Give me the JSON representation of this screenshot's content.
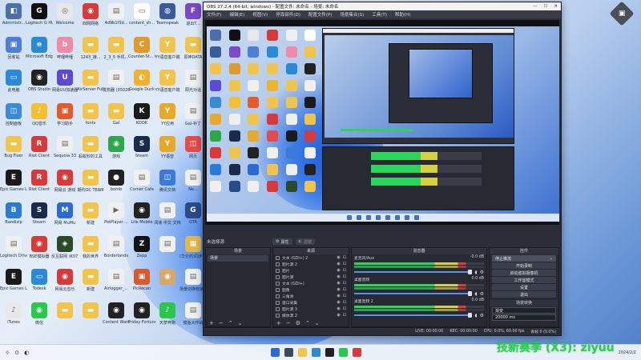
{
  "desktop": {
    "icons": [
      {
        "label": "Administr...",
        "color": "#4d6fa8",
        "glyph": "◧",
        "col": 0,
        "row": 0
      },
      {
        "label": "Logitech G HUB",
        "color": "#111111",
        "glyph": "G",
        "col": 1,
        "row": 0
      },
      {
        "label": "Welcome",
        "color": "#e8e8e8",
        "glyph": "◎",
        "col": 2,
        "row": 0
      },
      {
        "label": "四网网络",
        "color": "#d83a3a",
        "glyph": "◉",
        "col": 3,
        "row": 0
      },
      {
        "label": "4d9b1f3d...",
        "color": "#f0f0f0",
        "glyph": "▤",
        "col": 4,
        "row": 0
      },
      {
        "label": "content_sh...",
        "color": "#ffffff",
        "glyph": "▭",
        "col": 5,
        "row": 0
      },
      {
        "label": "Teamspeak",
        "color": "#3a5a9a",
        "glyph": "◍",
        "col": 6,
        "row": 0
      },
      {
        "label": "退出T...",
        "color": "#7a4ac8",
        "glyph": "F",
        "col": 7,
        "row": 0
      },
      {
        "label": "回收站",
        "color": "#4e7fd8",
        "glyph": "▣",
        "col": 0,
        "row": 1
      },
      {
        "label": "Microsoft Edge",
        "color": "#2a8ad8",
        "glyph": "e",
        "col": 1,
        "row": 1
      },
      {
        "label": "哔哩哔哩",
        "color": "#f08aa8",
        "glyph": "b",
        "col": 2,
        "row": 1
      },
      {
        "label": "1243_接...",
        "color": "#f2c44a",
        "glyph": "▬",
        "col": 3,
        "row": 1
      },
      {
        "label": "2_3_5 手机...",
        "color": "#f2c44a",
        "glyph": "▬",
        "col": 4,
        "row": 1
      },
      {
        "label": "Counter-St... Global Of...",
        "color": "#e09a2a",
        "glyph": "C",
        "col": 5,
        "row": 1
      },
      {
        "label": "YY语音客户端",
        "color": "#f2c44a",
        "glyph": "Y",
        "col": 6,
        "row": 1
      },
      {
        "label": "原神DATA",
        "color": "#f2c44a",
        "glyph": "▬",
        "col": 7,
        "row": 1
      },
      {
        "label": "此电脑",
        "color": "#2a8ad8",
        "glyph": "▭",
        "col": 0,
        "row": 2
      },
      {
        "label": "OBS Studio",
        "color": "#222222",
        "glyph": "◉",
        "col": 1,
        "row": 2
      },
      {
        "label": "网易UU加速器",
        "color": "#5a4ad8",
        "glyph": "U",
        "col": 2,
        "row": 2
      },
      {
        "label": "AirServer Full",
        "color": "#f2c44a",
        "glyph": "▬",
        "col": 3,
        "row": 2
      },
      {
        "label": "发热器 (35026)",
        "color": "#f0f0f0",
        "glyph": "▤",
        "col": 4,
        "row": 2
      },
      {
        "label": "Google Duck",
        "color": "#f0b22a",
        "glyph": "◐",
        "col": 5,
        "row": 2
      },
      {
        "label": "YY语音客户端",
        "color": "#f2c44a",
        "glyph": "Y",
        "col": 6,
        "row": 2
      },
      {
        "label": "阳光对话",
        "color": "#f0f0f0",
        "glyph": "▤",
        "col": 7,
        "row": 2
      },
      {
        "label": "控制面板",
        "color": "#3a8ad8",
        "glyph": "◫",
        "col": 0,
        "row": 3
      },
      {
        "label": "QQ音乐",
        "color": "#f2c030",
        "glyph": "♪",
        "col": 1,
        "row": 3
      },
      {
        "label": "学习助手",
        "color": "#e65a2a",
        "glyph": "▣",
        "col": 2,
        "row": 3
      },
      {
        "label": "fonts",
        "color": "#f2c44a",
        "glyph": "▬",
        "col": 3,
        "row": 3
      },
      {
        "label": "Gal",
        "color": "#f2c44a",
        "glyph": "▬",
        "col": 4,
        "row": 3
      },
      {
        "label": "KOOK",
        "color": "#1a1a1a",
        "glyph": "K",
        "col": 5,
        "row": 3
      },
      {
        "label": "YY应用",
        "color": "#e8a82a",
        "glyph": "Y",
        "col": 6,
        "row": 3
      },
      {
        "label": "Gal-补丁",
        "color": "#f0f0f0",
        "glyph": "▤",
        "col": 7,
        "row": 3
      },
      {
        "label": "Bug Fixer",
        "color": "#f2c44a",
        "glyph": "▬",
        "col": 0,
        "row": 4
      },
      {
        "label": "Riot Client",
        "color": "#d83a3a",
        "glyph": "R",
        "col": 1,
        "row": 4
      },
      {
        "label": "Sequoia 33",
        "color": "#f0f0f0",
        "glyph": "▤",
        "col": 2,
        "row": 4
      },
      {
        "label": "蚂蚁秒的工具",
        "color": "#f2c44a",
        "glyph": "▬",
        "col": 3,
        "row": 4
      },
      {
        "label": "游戏",
        "color": "#2aa84a",
        "glyph": "◉",
        "col": 4,
        "row": 4
      },
      {
        "label": "Steam",
        "color": "#1a2a4a",
        "glyph": "S",
        "col": 5,
        "row": 4
      },
      {
        "label": "YY语音",
        "color": "#e8a82a",
        "glyph": "Y",
        "col": 6,
        "row": 4
      },
      {
        "label": "网页",
        "color": "#e84a4a",
        "glyph": "◫",
        "col": 7,
        "row": 4
      },
      {
        "label": "Epic Games Launcher",
        "color": "#1a1a1a",
        "glyph": "E",
        "col": 0,
        "row": 5
      },
      {
        "label": "Riot Client",
        "color": "#d83a3a",
        "glyph": "R",
        "col": 1,
        "row": 5
      },
      {
        "label": "网易云 游戏",
        "color": "#d83a3a",
        "glyph": "◉",
        "col": 2,
        "row": 5
      },
      {
        "label": "期约OC TEAM",
        "color": "#f2c44a",
        "glyph": "▬",
        "col": 3,
        "row": 5
      },
      {
        "label": "bomb",
        "color": "#222222",
        "glyph": "●",
        "col": 4,
        "row": 5
      },
      {
        "label": "Corner Cafe",
        "color": "#f0f0f0",
        "glyph": "▤",
        "col": 5,
        "row": 5
      },
      {
        "label": "腾讯文档",
        "color": "#3a7ad8",
        "glyph": "◫",
        "col": 6,
        "row": 5
      },
      {
        "label": "Ne...",
        "color": "#f0f0f0",
        "glyph": "▤",
        "col": 7,
        "row": 5
      },
      {
        "label": "Bandizip",
        "color": "#2a7ad8",
        "glyph": "B",
        "col": 0,
        "row": 6
      },
      {
        "label": "Steam",
        "color": "#1a2a4a",
        "glyph": "S",
        "col": 1,
        "row": 6
      },
      {
        "label": "网易 MuMu",
        "color": "#2a6ad8",
        "glyph": "M",
        "col": 2,
        "row": 6
      },
      {
        "label": "新建",
        "color": "#f2c44a",
        "glyph": "▬",
        "col": 3,
        "row": 6
      },
      {
        "label": "PotPlayer ...",
        "color": "#f0f0f0",
        "glyph": "▶",
        "col": 4,
        "row": 6
      },
      {
        "label": "Lite Mobile",
        "color": "#222222",
        "glyph": "◉",
        "col": 5,
        "row": 6
      },
      {
        "label": "阅读 中文 文档",
        "color": "#f0f0f0",
        "glyph": "▤",
        "col": 6,
        "row": 6
      },
      {
        "label": "GTA",
        "color": "#2a4a8a",
        "glyph": "G",
        "col": 7,
        "row": 6
      },
      {
        "label": "Logitech Driver U...",
        "color": "#f0f0f0",
        "glyph": "▤",
        "col": 0,
        "row": 7
      },
      {
        "label": "BSE模拟器",
        "color": "#d83a3a",
        "glyph": "◉",
        "col": 1,
        "row": 7
      },
      {
        "label": "反互联网 (K07)",
        "color": "#2a4a2a",
        "glyph": "◈",
        "col": 2,
        "row": 7
      },
      {
        "label": "我的世界",
        "color": "#f2c44a",
        "glyph": "▬",
        "col": 3,
        "row": 7
      },
      {
        "label": "Borderlands",
        "color": "#f0f0f0",
        "glyph": "▤",
        "col": 4,
        "row": 7
      },
      {
        "label": "Zepp",
        "color": "#111111",
        "glyph": "Z",
        "col": 5,
        "row": 7
      },
      {
        "label": "",
        "color": "#f0f0f0",
        "glyph": "▤",
        "col": 6,
        "row": 7
      },
      {
        "label": "(华仑的)同步 工具箱",
        "color": "#e0b84a",
        "glyph": "▦",
        "col": 7,
        "row": 7
      },
      {
        "label": "Epic Games Launcher",
        "color": "#1a1a1a",
        "glyph": "E",
        "col": 0,
        "row": 8
      },
      {
        "label": "Todesk",
        "color": "#2a8ad8",
        "glyph": "▭",
        "col": 1,
        "row": 8
      },
      {
        "label": "网易云音乐",
        "color": "#d83a3a",
        "glyph": "◉",
        "col": 2,
        "row": 8
      },
      {
        "label": "新建",
        "color": "#f2c44a",
        "glyph": "▬",
        "col": 3,
        "row": 8
      },
      {
        "label": "Airlogger_...",
        "color": "#f0f0f0",
        "glyph": "▤",
        "col": 4,
        "row": 8
      },
      {
        "label": "PicRecan",
        "color": "#d85a2a",
        "glyph": "▣",
        "col": 5,
        "row": 8
      },
      {
        "label": "",
        "color": "#d8a86a",
        "glyph": "◉",
        "col": 6,
        "row": 8
      },
      {
        "label": "场景切换管家 (精)...com",
        "color": "#f0f0f0",
        "glyph": "▤",
        "col": 7,
        "row": 8
      },
      {
        "label": "iTunes",
        "color": "#e8e8e8",
        "glyph": "♪",
        "col": 0,
        "row": 9
      },
      {
        "label": "微信",
        "color": "#2ac84a",
        "glyph": "◉",
        "col": 1,
        "row": 9
      },
      {
        "label": "",
        "color": "#f2c44a",
        "glyph": "▬",
        "col": 2,
        "row": 9
      },
      {
        "label": "",
        "color": "#f2c44a",
        "glyph": "▬",
        "col": 3,
        "row": 9
      },
      {
        "label": "Content Warning",
        "color": "#222222",
        "glyph": "◉",
        "col": 4,
        "row": 9
      },
      {
        "label": "Friday Fortune ...",
        "color": "#222222",
        "glyph": "◉",
        "col": 5,
        "row": 9
      },
      {
        "label": "天梦奔跑",
        "color": "#2ac84a",
        "glyph": "♪",
        "col": 6,
        "row": 9
      },
      {
        "label": "摸鱼大作战",
        "color": "#f0f0f0",
        "glyph": "▤",
        "col": 7,
        "row": 9
      }
    ]
  },
  "corner_icon": {
    "label": "",
    "glyph": "▣"
  },
  "obs": {
    "title": "OBS 27.2.4 (64-bit, windows) - 配置文件: 未命名 - 场景: 未命名",
    "menu": [
      "文件(F)",
      "编辑(E)",
      "视图(V)",
      "停靠部件(D)",
      "配置文件(P)",
      "场景集合(S)",
      "工具(T)",
      "帮助(H)"
    ],
    "preview_label": "未选择源",
    "tabs": [
      "属性",
      "滤镜"
    ],
    "scenes": {
      "header": "场景",
      "items": [
        "场景"
      ]
    },
    "sources": {
      "header": "来源",
      "items": [
        "文本 (GDI+) 2",
        "图片源 2",
        "图片",
        "图片源",
        "文本 (GDI+)",
        "图像",
        "三角洲",
        "窗口采集",
        "图片源 3",
        "媒体源 2"
      ]
    },
    "mixer": {
      "header": "混音器",
      "channels": [
        {
          "name": "麦克风/Aux",
          "db": "-0.0 dB"
        },
        {
          "name": "桌面音频",
          "db": "0.0 dB"
        },
        {
          "name": "桌面音频 2",
          "db": "0.0 dB"
        }
      ]
    },
    "controls": {
      "header": "控件",
      "buttons": [
        "停止推流",
        "开始录制",
        "启动虚拟摄像机",
        "工作室模式",
        "设置",
        "退出"
      ],
      "transition_header": "场景转换",
      "transition_value": "渐变",
      "duration_value": "20000 ms"
    },
    "status": {
      "live": "LIVE: 00:00:00",
      "rec": "REC: 00:00:00",
      "cpu": "CPU: 0.0%, 60.00 fps",
      "lost": "丢帧 0 (0.0%)"
    }
  },
  "taskbar": {
    "left_glyphs": [
      "☼",
      "⊙",
      "◐"
    ],
    "time": "",
    "date": "2024/2/2"
  },
  "watermark": {
    "text": "技新赛季 (X3): ziyuu"
  }
}
